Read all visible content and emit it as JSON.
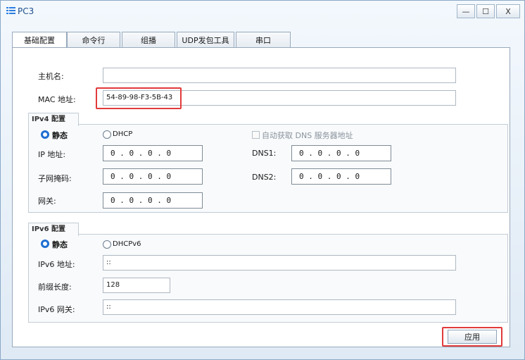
{
  "window": {
    "title": "PC3",
    "minimize_label": "—",
    "maximize_label": "☐",
    "close_label": "X"
  },
  "tabs": [
    {
      "label": "基础配置"
    },
    {
      "label": "命令行"
    },
    {
      "label": "组播"
    },
    {
      "label": "UDP发包工具"
    },
    {
      "label": "串口"
    }
  ],
  "basic": {
    "hostname_label": "主机名:",
    "hostname_value": "",
    "mac_label": "MAC 地址:",
    "mac_value": "54-89-98-F3-5B-43"
  },
  "ipv4": {
    "group_title": "IPv4 配置",
    "static_label": "静态",
    "dhcp_label": "DHCP",
    "auto_dns_label": "自动获取 DNS 服务器地址",
    "ip_label": "IP 地址:",
    "ip_value": "0 . 0 . 0 . 0",
    "mask_label": "子网掩码:",
    "mask_value": "0 . 0 . 0 . 0",
    "gateway_label": "网关:",
    "gateway_value": "0 . 0 . 0 . 0",
    "dns1_label": "DNS1:",
    "dns1_value": "0 . 0 . 0 . 0",
    "dns2_label": "DNS2:",
    "dns2_value": "0 . 0 . 0 . 0"
  },
  "ipv6": {
    "group_title": "IPv6 配置",
    "static_label": "静态",
    "dhcp_label": "DHCPv6",
    "address_label": "IPv6 地址:",
    "address_value": "::",
    "prefix_label": "前缀长度:",
    "prefix_value": "128",
    "gateway_label": "IPv6 网关:",
    "gateway_value": "::"
  },
  "footer": {
    "apply_label": "应用"
  },
  "colors": {
    "accent": "#1f6fd1",
    "highlight": "#e23a3a",
    "title_text": "#1f4e8c"
  }
}
